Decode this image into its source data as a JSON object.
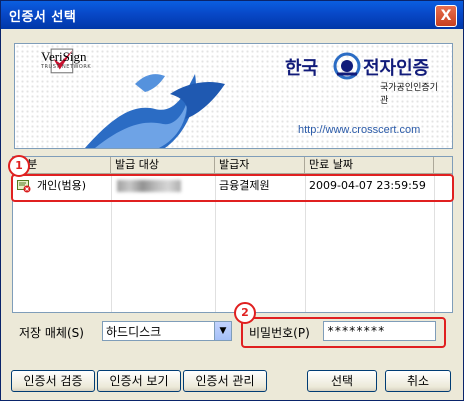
{
  "window": {
    "title": "인증서 선택",
    "close_label": "X"
  },
  "banner": {
    "verisign_name": "VeriSign",
    "verisign_sub": "TRUST NETWORK",
    "brand_left": "한국",
    "brand_right": "전자인증",
    "subtitle": "국가공인인증기관",
    "url": "http://www.crosscert.com"
  },
  "table": {
    "columns": [
      "구분",
      "발급 대상",
      "발급자",
      "만료 날짜"
    ],
    "rows": [
      {
        "type": "개인(범용)",
        "subject": "",
        "issuer": "금융결제원",
        "expiry": "2009-04-07 23:59:59",
        "icon": "certificate-icon"
      }
    ]
  },
  "storage": {
    "label": "저장 매체(S)",
    "value": "하드디스크"
  },
  "password": {
    "label": "비밀번호(P)",
    "value": "********"
  },
  "buttons": {
    "verify": "인증서 검증",
    "view": "인증서 보기",
    "manage": "인증서 관리",
    "select": "선택",
    "cancel": "취소"
  },
  "badges": [
    "1",
    "2"
  ],
  "colors": {
    "highlight": "#e02020",
    "title_bar": "#0848c8"
  }
}
